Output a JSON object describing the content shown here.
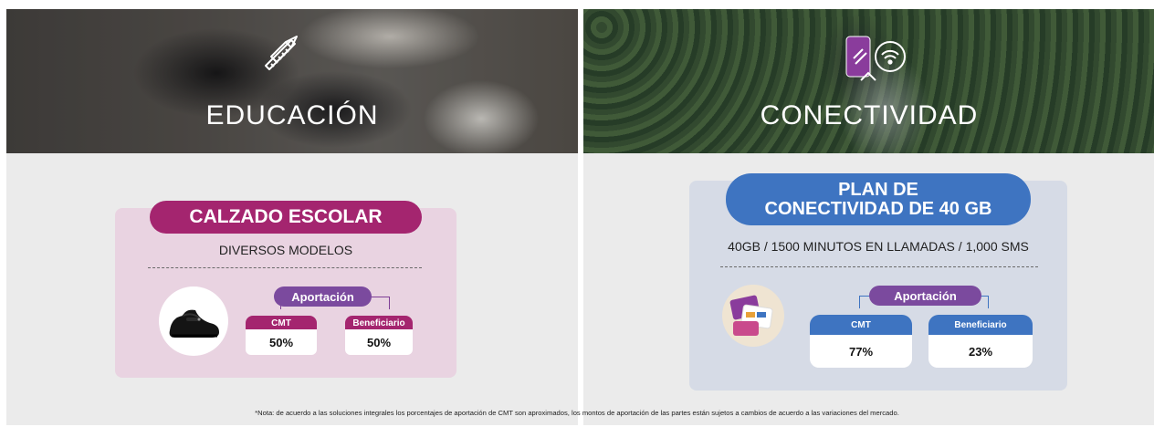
{
  "education": {
    "banner_title": "EDUCACIÓN",
    "icon": "pencil-ruler-icon",
    "card_title": "CALZADO ESCOLAR",
    "subtitle": "DIVERSOS MODELOS",
    "contribution_label": "Aportación",
    "cmt_label": "CMT",
    "cmt_value": "50%",
    "beneficiary_label": "Beneficiario",
    "beneficiary_value": "50%",
    "accent_color": "#a4256f",
    "card_color": "#e9d3e1"
  },
  "connectivity": {
    "banner_title": "CONECTIVIDAD",
    "icon": "phone-wifi-icon",
    "card_title_line1": "PLAN DE",
    "card_title_line2": "CONECTIVIDAD DE 40 GB",
    "subtitle": "40GB / 1500 MINUTOS EN LLAMADAS / 1,000 SMS",
    "contribution_label": "Aportación",
    "cmt_label": "CMT",
    "cmt_value": "77%",
    "beneficiary_label": "Beneficiario",
    "beneficiary_value": "23%",
    "accent_color": "#3e74c1",
    "card_color": "#d6dbe6"
  },
  "footnote": "*Nota: de acuerdo a las soluciones integrales los porcentajes de aportación de CMT son aproximados, los montos de aportación de las partes están sujetos a cambios de acuerdo a las variaciones del mercado."
}
